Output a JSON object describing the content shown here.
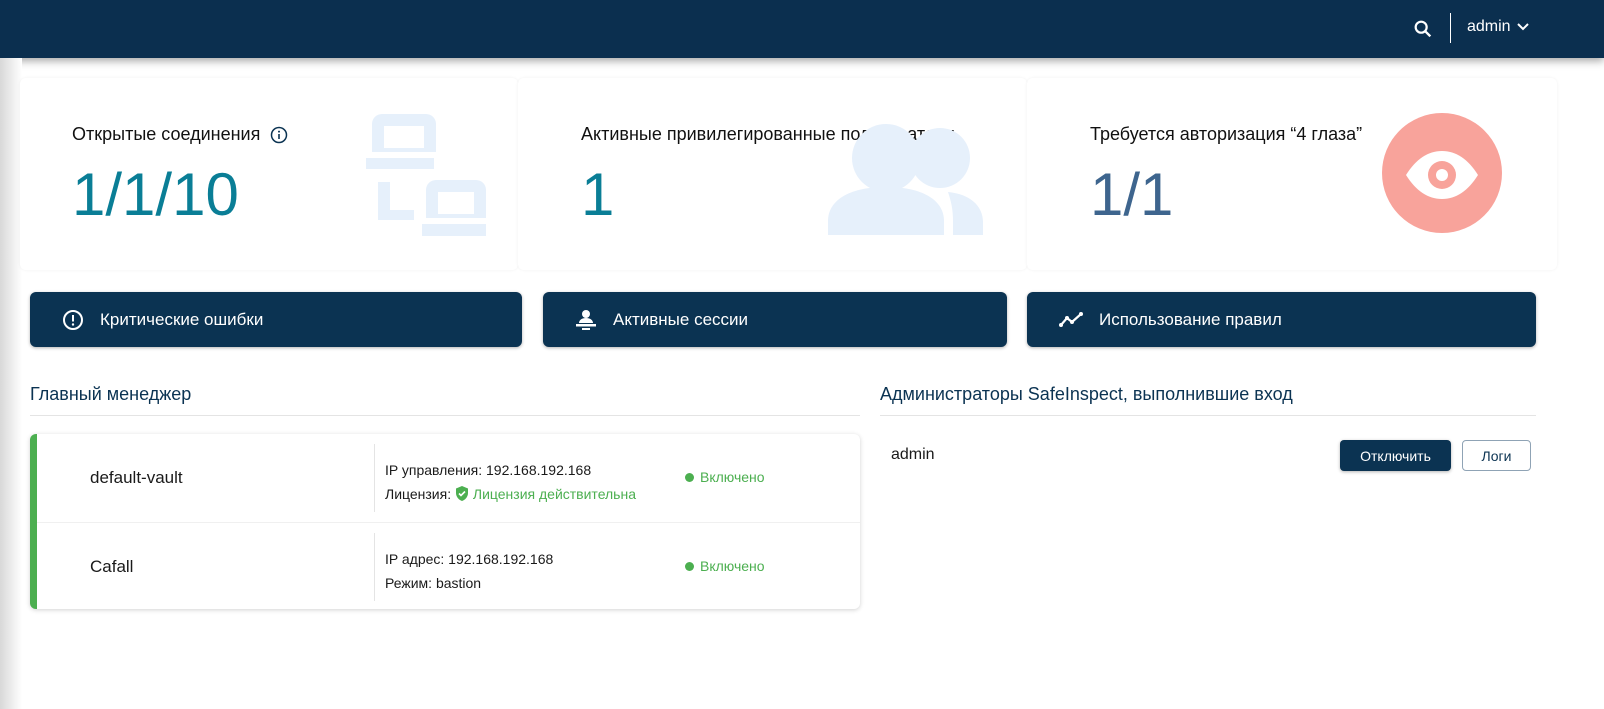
{
  "header": {
    "user": "admin",
    "colors": {
      "bar": "#0b2f4f"
    }
  },
  "cards": [
    {
      "title": "Открытые соединения",
      "value": "1/1/10",
      "icon": "network-icon",
      "color": "#0a7e96"
    },
    {
      "title": "Активные привилегированные пользователи",
      "value": "1",
      "icon": "users-icon",
      "color": "#0a7e96"
    },
    {
      "title": "Требуется авторизация “4 глаза”",
      "value": "1/1",
      "icon": "eye-icon",
      "color": "#3e658e"
    }
  ],
  "buttons": [
    {
      "label": "Критические ошибки",
      "icon": "alert-circle-icon"
    },
    {
      "label": "Активные сессии",
      "icon": "session-user-icon"
    },
    {
      "label": "Использование правил",
      "icon": "trend-line-icon"
    }
  ],
  "manager": {
    "title": "Главный менеджер",
    "rows": [
      {
        "name": "default-vault",
        "line1": "IP управления: 192.168.192.168",
        "line2_label": "Лицензия:",
        "line2_value": "Лицензия действительна",
        "status": "Включено"
      },
      {
        "name": "Cafall",
        "line1": "IP адрес: 192.168.192.168",
        "line2_label": "Режим: bastion",
        "status": "Включено"
      }
    ]
  },
  "admins": {
    "title": "Администраторы SafeInspect, выполнившие вход",
    "items": [
      {
        "name": "admin",
        "disconnect": "Отключить",
        "logs": "Логи"
      }
    ]
  }
}
